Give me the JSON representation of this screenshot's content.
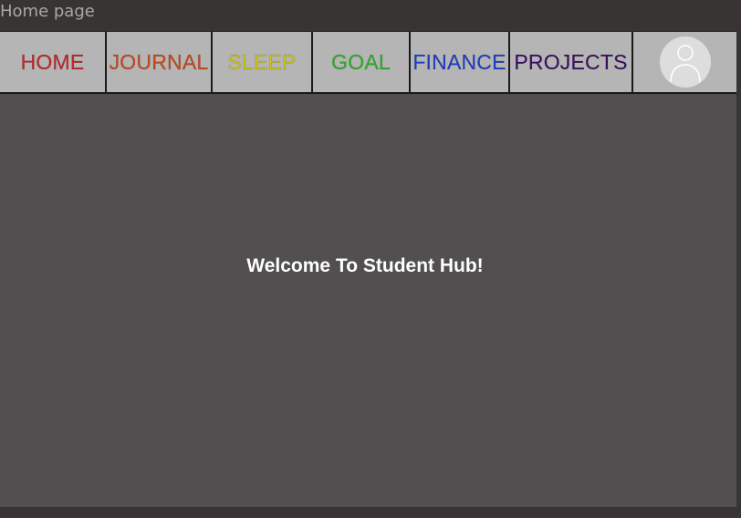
{
  "window": {
    "title": "Home page"
  },
  "nav": {
    "items": [
      {
        "label": "HOME",
        "color": "#c0262a"
      },
      {
        "label": "JOURNAL",
        "color": "#c44a1c"
      },
      {
        "label": "SLEEP",
        "color": "#c9c31e"
      },
      {
        "label": "GOAL",
        "color": "#2fae2b"
      },
      {
        "label": "FINANCE",
        "color": "#1f3fc7"
      },
      {
        "label": "PROJECTS",
        "color": "#3b0f63"
      }
    ],
    "avatar_icon": "user-avatar-icon"
  },
  "main": {
    "welcome": "Welcome To Student Hub!"
  },
  "colors": {
    "background": "#383434",
    "frame": "#524f50",
    "nav_bg": "#b5b5b5"
  }
}
